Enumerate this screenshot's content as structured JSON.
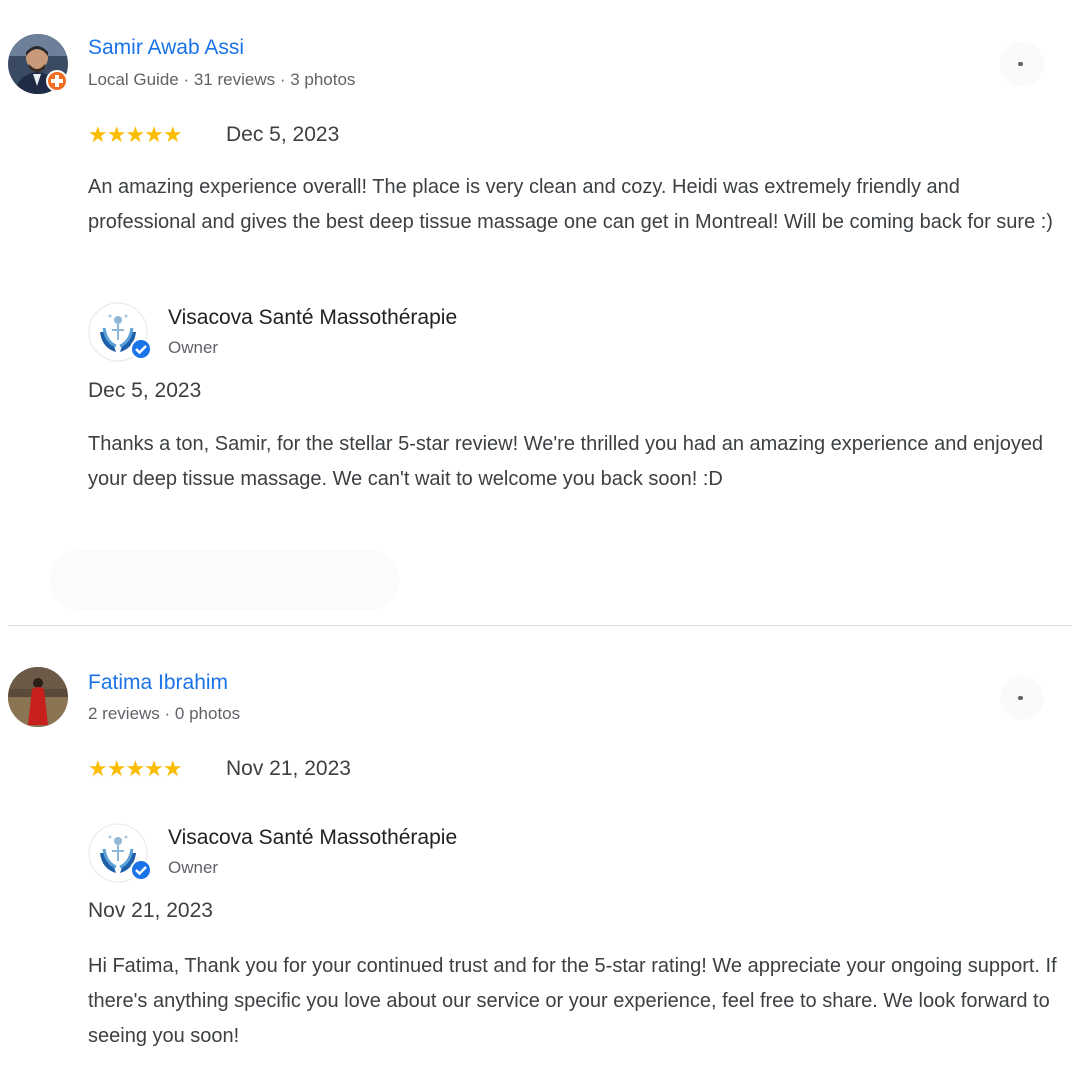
{
  "reviews": [
    {
      "reviewer_name": "Samir Awab Assi",
      "reviewer_meta": "Local Guide · 31 reviews · 3 photos",
      "stars": "★★★★★",
      "rating": 5,
      "date": "Dec 5, 2023",
      "text": "An amazing experience overall! The place is very clean and cozy. Heidi was extremely friendly and professional and gives the best deep tissue massage one can get in Montreal! Will be coming back for sure :)",
      "owner_reply": {
        "name": "Visacova Santé Massothérapie",
        "role": "Owner",
        "date": "Dec 5, 2023",
        "text": "Thanks a ton, Samir, for the stellar 5-star review! We're thrilled you had an amazing experience and enjoyed your deep tissue massage. We can't wait to welcome you back soon! :D"
      }
    },
    {
      "reviewer_name": "Fatima Ibrahim",
      "reviewer_meta": "2 reviews · 0 photos",
      "stars": "★★★★★",
      "rating": 5,
      "date": "Nov 21, 2023",
      "text": "",
      "owner_reply": {
        "name": "Visacova Santé Massothérapie",
        "role": "Owner",
        "date": "Nov 21, 2023",
        "text": "Hi Fatima, Thank you for your continued trust and for the 5-star rating! We appreciate your ongoing support. If there's anything specific you love about our service or your experience, feel free to share. We look forward to seeing you soon!"
      }
    }
  ],
  "icons": {
    "more_options": "more-options-icon",
    "star": "star-icon",
    "verified": "verified-check-icon",
    "local_guide": "local-guide-badge-icon"
  },
  "colors": {
    "reviewer_name": "#1a73e8",
    "stars": "#fbbc04",
    "local_guide_badge": "#f36c22",
    "verified_badge": "#1a73e8"
  }
}
